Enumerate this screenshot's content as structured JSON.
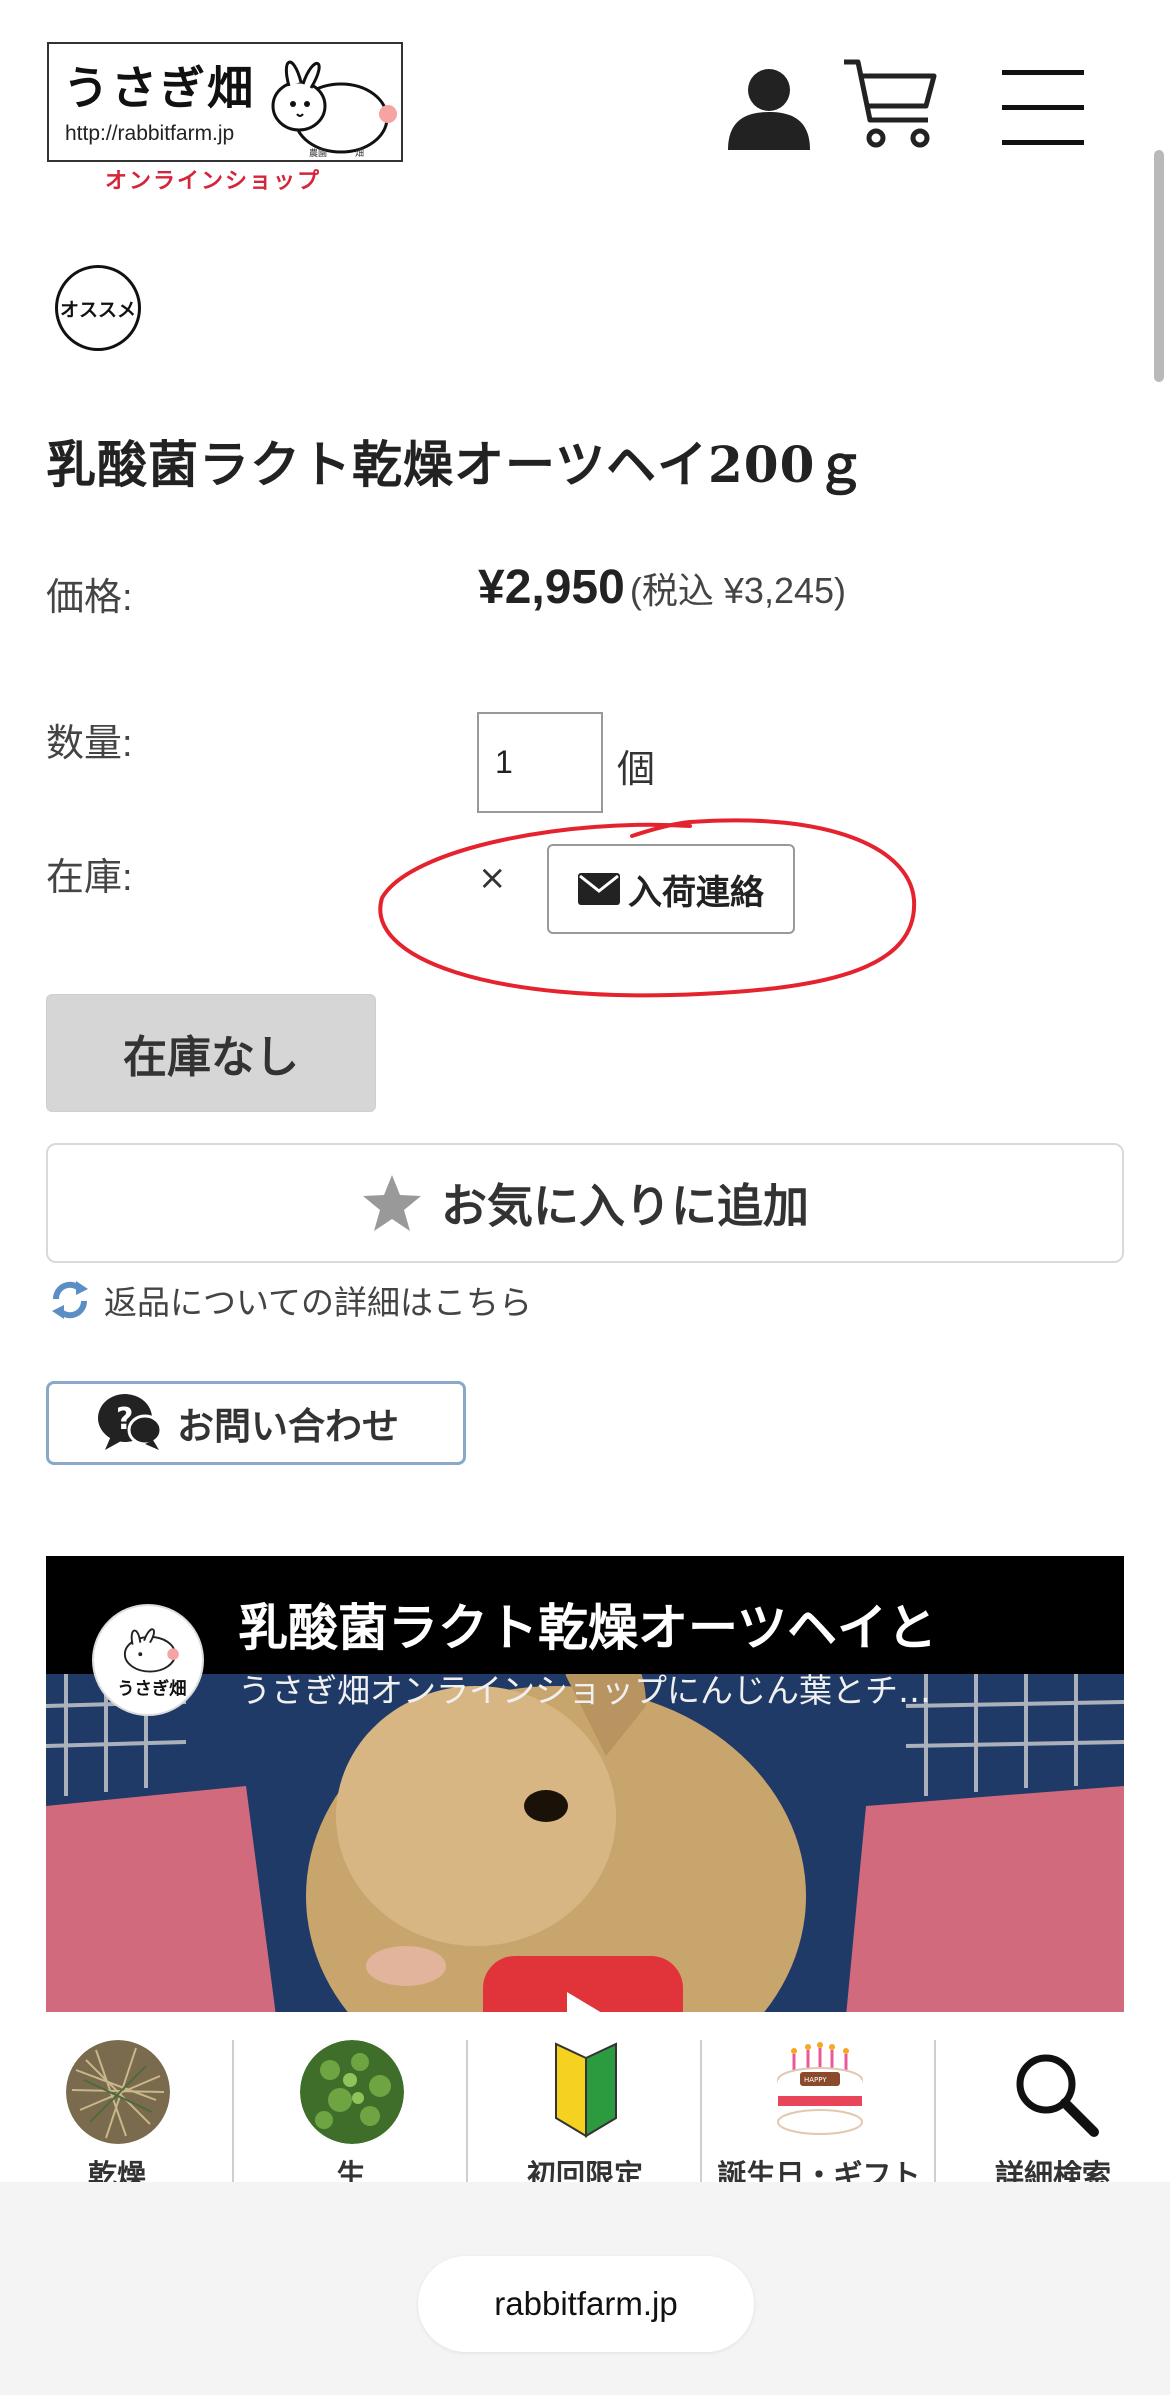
{
  "header": {
    "logo_title": "うさぎ畑",
    "logo_url": "http://rabbitfarm.jp",
    "logo_subtitle": "オンラインショップ",
    "account_icon": "user-icon",
    "cart_icon": "cart-icon",
    "menu_icon": "hamburger-menu-icon"
  },
  "product": {
    "badge": "オススメ",
    "title": "乳酸菌ラクト乾燥オーツヘイ200ｇ",
    "price_label": "価格:",
    "price": "¥2,950",
    "price_tax": "(税込 ¥3,245)",
    "quantity_label": "数量:",
    "quantity_value": "1",
    "quantity_unit": "個",
    "stock_label": "在庫:",
    "stock_status": "×",
    "notify_button": "入荷連絡",
    "sold_out_button": "在庫なし",
    "favorite_button": "お気に入りに追加",
    "return_link": "返品についての詳細はこちら",
    "contact_button": "お問い合わせ"
  },
  "video": {
    "title": "乳酸菌ラクト乾燥オーツヘイと",
    "channel_line": "うさぎ畑オンラインショップにんじん葉とチ…",
    "channel_avatar_text": "うさぎ畑"
  },
  "bottom_nav": {
    "items": [
      {
        "label": "乾燥",
        "icon": "dried-hay-photo"
      },
      {
        "label": "生",
        "icon": "fresh-grass-photo"
      },
      {
        "label": "初回限定",
        "icon": "beginner-mark-icon"
      },
      {
        "label": "誕生日・ギフト",
        "icon": "birthday-cake-icon"
      },
      {
        "label": "詳細検索",
        "icon": "search-icon"
      }
    ]
  },
  "browser": {
    "url": "rabbitfarm.jp"
  },
  "colors": {
    "accent_red": "#d6253a",
    "sold_out_bg": "#d6d6d6",
    "contact_border": "#8aa8c8",
    "play_red": "#e1333a"
  }
}
